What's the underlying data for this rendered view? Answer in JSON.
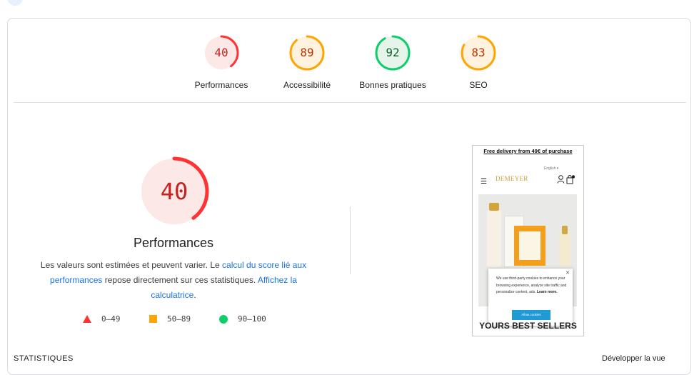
{
  "gauges": [
    {
      "score": "40",
      "label": "Performances",
      "color": "#c5221f",
      "ring": "#ff3333",
      "bg": "#fce8e6",
      "fraction": 0.4
    },
    {
      "score": "89",
      "label": "Accessibilité",
      "color": "#c33300",
      "ring": "#ffa400",
      "bg": "#fff3e0",
      "fraction": 0.89
    },
    {
      "score": "92",
      "label": "Bonnes pratiques",
      "color": "#0d652d",
      "ring": "#0cce6b",
      "bg": "#e6f4ea",
      "fraction": 0.92
    },
    {
      "score": "83",
      "label": "SEO",
      "color": "#c33300",
      "ring": "#ffa400",
      "bg": "#fff3e0",
      "fraction": 0.83
    }
  ],
  "main": {
    "score": "40",
    "fraction": 0.4,
    "title": "Performances",
    "desc_1": "Les valeurs sont estimées et peuvent varier. Le ",
    "link_1": "calcul du score lié aux performances",
    "desc_2": " repose directement sur ces statistiques. ",
    "link_2": "Affichez la calculatrice",
    "desc_3": "."
  },
  "legend": {
    "fail": "0–49",
    "average": "50–89",
    "pass": "90–100"
  },
  "bottom": {
    "left": "STATISTIQUES",
    "right": "Développer la vue"
  },
  "screenshot": {
    "banner": "Free delivery from 49€ of purchase",
    "language": "English",
    "logo": "DEMEYER",
    "cookie_text": "We use third-party cookies to enhance your browsing experience, analyze site traffic and personalize content, ads.",
    "cookie_link": "Learn more.",
    "cookie_button": "Allow cookies",
    "section_title": "YOURS BEST SELLERS"
  }
}
